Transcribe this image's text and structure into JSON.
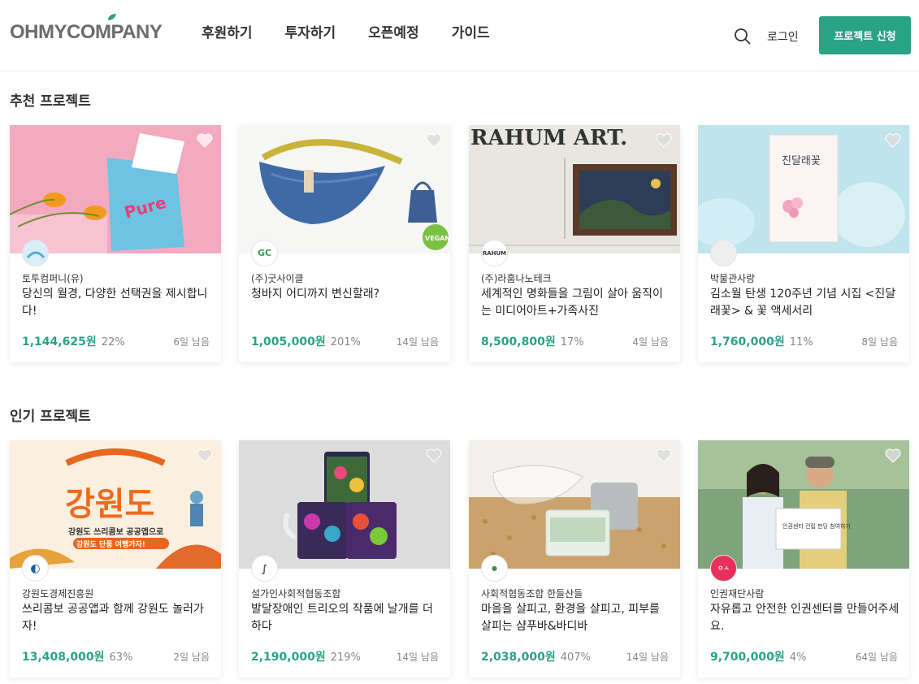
{
  "header": {
    "logo": "OHMYCOMPANY",
    "nav": [
      "후원하기",
      "투자하기",
      "오픈예정",
      "가이드"
    ],
    "login": "로그인",
    "apply": "프로젝트 신청"
  },
  "sections": [
    {
      "title": "추천 프로젝트",
      "cards": [
        {
          "maker": "토투컴퍼니(유)",
          "title": "당신의 월경, 다양한 선택권을 제시합니다!",
          "amount": "1,144,625원",
          "percent": "22%",
          "days": "6일 남음"
        },
        {
          "maker": "(주)굿사이클",
          "title": "청바지 어디까지 변신할래?",
          "amount": "1,005,000원",
          "percent": "201%",
          "days": "14일 남음"
        },
        {
          "maker": "(주)라훔나노테크",
          "title": "세계적인 명화들을 그림이 살아 움직이는 미디어아트+가족사진",
          "amount": "8,500,800원",
          "percent": "17%",
          "days": "4일 남음"
        },
        {
          "maker": "박물관사랑",
          "title": "김소월 탄생 120주년 기념 시집 <진달래꽃> & 꽃 액세서리",
          "amount": "1,760,000원",
          "percent": "11%",
          "days": "8일 남음"
        }
      ]
    },
    {
      "title": "인기 프로젝트",
      "cards": [
        {
          "maker": "강원도경제진흥원",
          "title": "쓰리콤보 공공앱과 함께 강원도 놀러가자!",
          "amount": "13,408,000원",
          "percent": "63%",
          "days": "2일 남음"
        },
        {
          "maker": "설가인사회적협동조합",
          "title": "발달장애인 트리오의 작품에 날개를 더하다",
          "amount": "2,190,000원",
          "percent": "219%",
          "days": "14일 남음"
        },
        {
          "maker": "사회적협동조합 한들산들",
          "title": "마을을 살피고, 환경을 살피고, 피부를 살피는 샴푸바&바디바",
          "amount": "2,038,000원",
          "percent": "407%",
          "days": "14일 남음"
        },
        {
          "maker": "인권재단사람",
          "title": "자유롭고 안전한 인권센터를 만들어주세요.",
          "amount": "9,700,000원",
          "percent": "4%",
          "days": "64일 남음"
        }
      ]
    }
  ],
  "thumb_text": {
    "rahum": "RAHUM ART.",
    "gangwon": "강원도",
    "gangwon_sub": "강원도 쓰리콤보 공공앱으로",
    "gangwon_sub2": "강원도 단풍 여행가자!",
    "poem": "진달래꽃",
    "sign": "인권센터 건립 펀딩 참여하기",
    "vegan": "VEGAN"
  },
  "colors": {
    "accent": "#2aa286"
  }
}
